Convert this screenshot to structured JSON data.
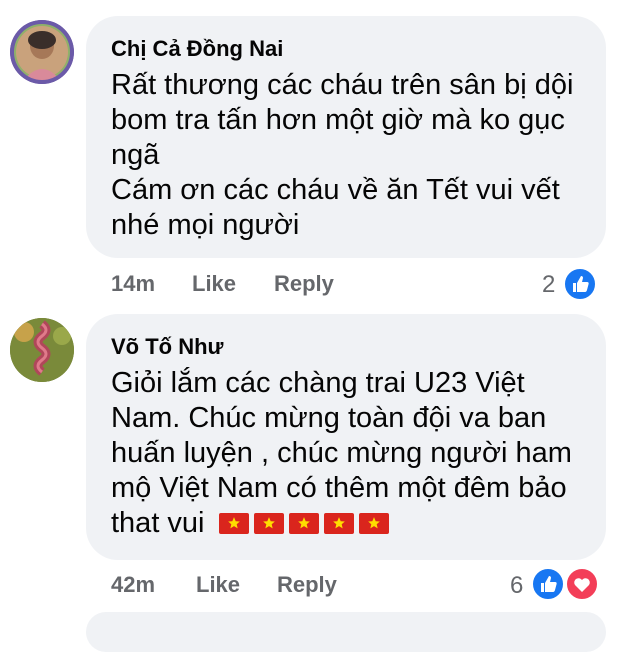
{
  "comments": [
    {
      "author": "Chị Cả Đồng Nai",
      "lines": [
        "Rất thương các cháu trên sân bị dội",
        "bom tra tấn hơn một giờ mà ko gục",
        "ngã",
        "Cám ơn các cháu về ăn Tết vui vết",
        "nhé mọi người"
      ],
      "time": "14m",
      "like_label": "Like",
      "reply_label": "Reply",
      "reaction_count": "2",
      "reactions": [
        "like-icon"
      ]
    },
    {
      "author": "Võ Tố Như",
      "lines": [
        "Giỏi lắm các chàng trai U23 Việt",
        "Nam. Chúc mừng toàn đội va ban",
        "huấn luyện , chúc mừng người ham",
        "mộ Việt Nam có thêm một đêm bảo",
        "that vui"
      ],
      "flag_count": 5,
      "time": "42m",
      "like_label": "Like",
      "reply_label": "Reply",
      "reaction_count": "6",
      "reactions": [
        "like-icon",
        "love-icon"
      ]
    }
  ],
  "colors": {
    "bubble": "#f0f2f5",
    "meta_text": "#65676b",
    "like_blue": "#1877f2",
    "love_red": "#f33e58",
    "flag_red": "#da251d",
    "flag_star": "#ffde00"
  }
}
